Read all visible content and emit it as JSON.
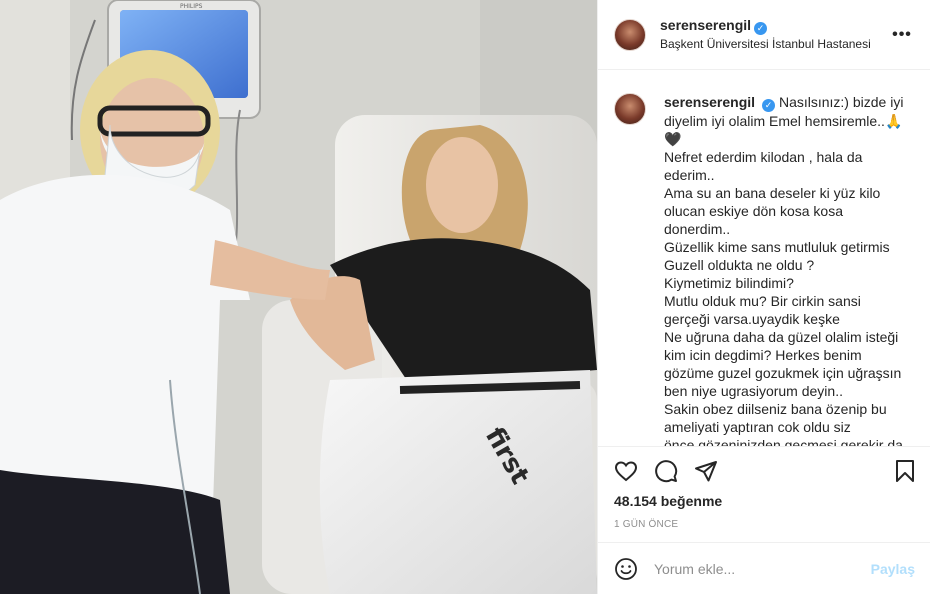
{
  "post": {
    "username": "serenserengil",
    "verified_glyph": "✓",
    "location": "Başkent Üniversitesi İstanbul Hastanesi",
    "more_icon": "more-horizontal-icon"
  },
  "photo": {
    "monitor_brand": "PHILIPS"
  },
  "caption": {
    "username": "serenserengil",
    "lines": [
      "Nasılsınız:) bizde iyi",
      "diyelim iyi olalim Emel hemsiremle..🙏",
      "🖤",
      "Nefret ederdim kilodan , hala da",
      "ederim..",
      "Ama su an bana deseler ki yüz kilo",
      "olucan eskiye dön kosa kosa",
      "donerdim..",
      "Güzellik kime sans mutluluk getirmis",
      "Guzell oldukta ne oldu ?",
      "Kiymetimiz bilindimi?",
      "Mutlu olduk mu? Bir cirkin sansi",
      "gerçeği varsa.uyaydik keşke",
      "Ne uğruna daha da güzel olalim isteği",
      "kim icin degdimi? Herkes benim",
      "gözüme guzel gozukmek için uğraşsın",
      "ben niye ugrasiyorum deyin..",
      "Sakin obez diilseniz bana özenip bu",
      "ameliyati yaptıran cok oldu siz",
      "önce gözeninizden geçmesi gerekir da"
    ]
  },
  "actions": {
    "like_icon": "heart-icon",
    "comment_icon": "comment-icon",
    "share_icon": "share-icon",
    "save_icon": "bookmark-icon",
    "likes_text": "48.154 beğenme",
    "time_text": "1 GÜN ÖNCE"
  },
  "comment": {
    "emoji_icon": "emoji-icon",
    "placeholder": "Yorum ekle...",
    "post_label": "Paylaş"
  },
  "colors": {
    "verified": "#3897f0",
    "post_button_disabled": "#b2dffc",
    "muted_text": "#8e8e8e",
    "border": "#efefef"
  }
}
